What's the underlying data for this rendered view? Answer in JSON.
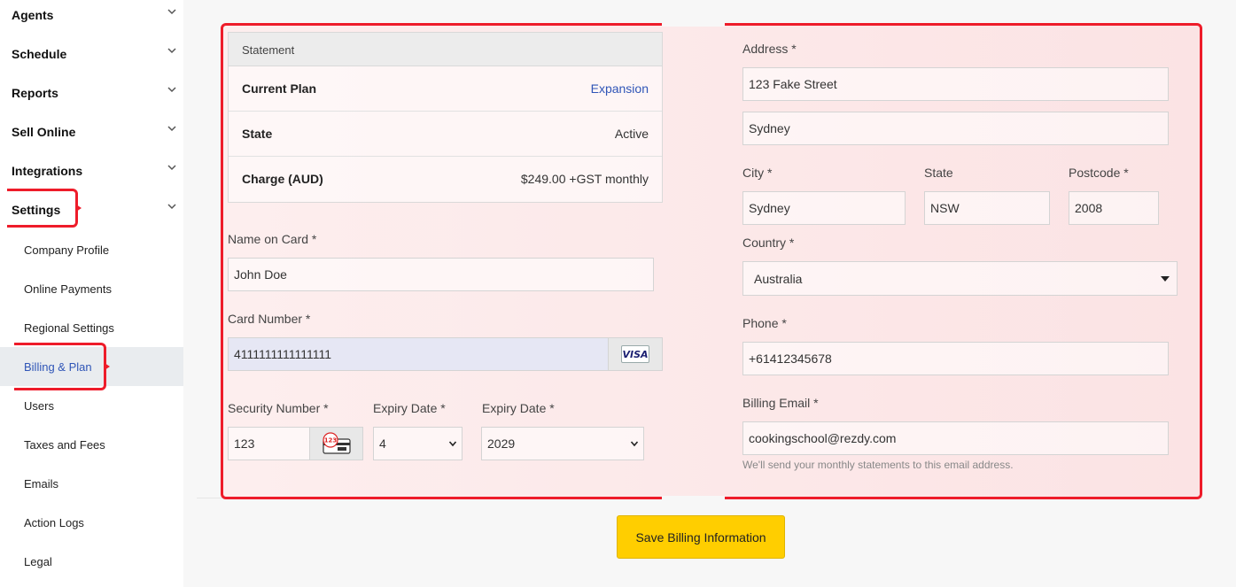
{
  "sidebar": {
    "sections": [
      {
        "label": "Agents"
      },
      {
        "label": "Schedule"
      },
      {
        "label": "Reports"
      },
      {
        "label": "Sell Online"
      },
      {
        "label": "Integrations"
      },
      {
        "label": "Settings"
      }
    ],
    "settings_items": [
      {
        "label": "Company Profile"
      },
      {
        "label": "Online Payments"
      },
      {
        "label": "Regional Settings"
      },
      {
        "label": "Billing & Plan",
        "active": true
      },
      {
        "label": "Users"
      },
      {
        "label": "Taxes and Fees"
      },
      {
        "label": "Emails"
      },
      {
        "label": "Action Logs"
      },
      {
        "label": "Legal"
      }
    ]
  },
  "statement": {
    "heading": "Statement",
    "rows": [
      {
        "key": "Current Plan",
        "value": "Expansion"
      },
      {
        "key": "State",
        "value": "Active"
      },
      {
        "key": "Charge (AUD)",
        "value": "$249.00 +GST monthly"
      }
    ]
  },
  "card": {
    "name_label": "Name on Card *",
    "name_value": "John Doe",
    "number_label": "Card Number *",
    "number_value": "4111111111111111",
    "brand": "VISA",
    "security_label": "Security Number *",
    "security_value": "123",
    "security_icon_text": "123",
    "expiry_month_label": "Expiry Date *",
    "expiry_month_value": "4",
    "expiry_year_label": "Expiry Date *",
    "expiry_year_value": "2029"
  },
  "address": {
    "address_label": "Address *",
    "line1": "123 Fake Street",
    "line2": "Sydney",
    "city_label": "City *",
    "city_value": "Sydney",
    "state_label": "State",
    "state_value": "NSW",
    "postcode_label": "Postcode *",
    "postcode_value": "2008",
    "country_label": "Country *",
    "country_value": "Australia",
    "phone_label": "Phone *",
    "phone_value": "+61412345678",
    "email_label": "Billing Email *",
    "email_value": "cookingschool@rezdy.com",
    "email_hint": "We'll send your monthly statements to this email address."
  },
  "actions": {
    "save_label": "Save Billing Information"
  },
  "colors": {
    "accent": "#ffce00",
    "highlight": "#ee1c2a",
    "link": "#2f55b7"
  }
}
